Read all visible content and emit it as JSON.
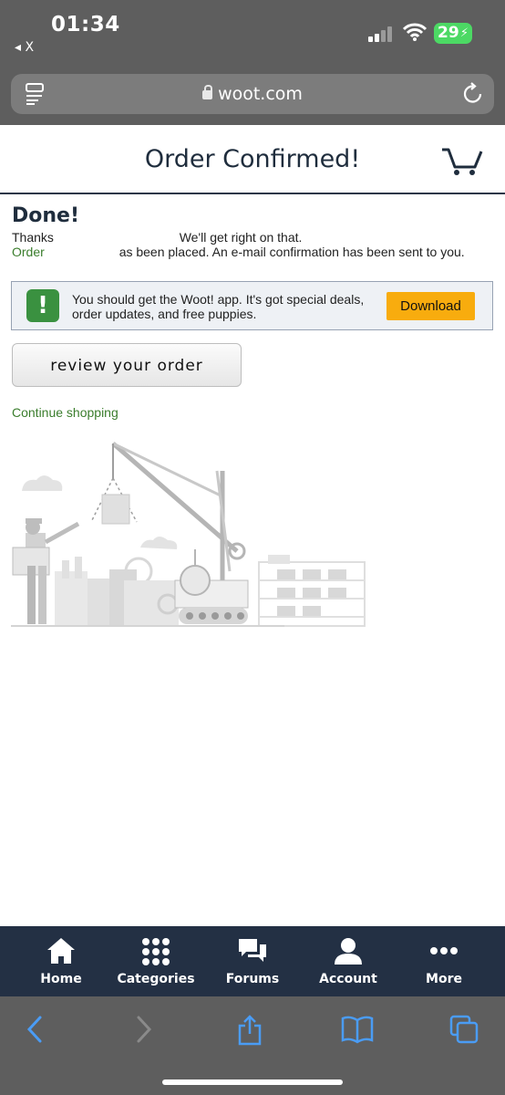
{
  "status_bar": {
    "time": "01:34",
    "back_app": "◂ X",
    "battery": "29"
  },
  "browser": {
    "url": "woot.com"
  },
  "header": {
    "title": "Order Confirmed!"
  },
  "content": {
    "done_title": "Done!",
    "thanks_start": "Thanks",
    "thanks_end": "We'll get right on that.",
    "order_label": "Order",
    "order_rest": "as been placed. An e-mail confirmation has been sent to you."
  },
  "app_banner": {
    "icon_glyph": "!",
    "text": "You should get the Woot! app. It's got special deals, order updates, and free puppies.",
    "download_label": "Download"
  },
  "review_button_label": "review your order",
  "continue_link_label": "Continue shopping",
  "bottom_nav": [
    {
      "label": "Home",
      "icon": "home-icon"
    },
    {
      "label": "Categories",
      "icon": "grid-icon"
    },
    {
      "label": "Forums",
      "icon": "chat-icon"
    },
    {
      "label": "Account",
      "icon": "user-icon"
    },
    {
      "label": "More",
      "icon": "more-icon"
    }
  ],
  "colors": {
    "accent_green": "#3a7d2c",
    "download_orange": "#f8ac0e",
    "nav_bg": "#233044",
    "safari_blue": "#4a9cf5"
  }
}
